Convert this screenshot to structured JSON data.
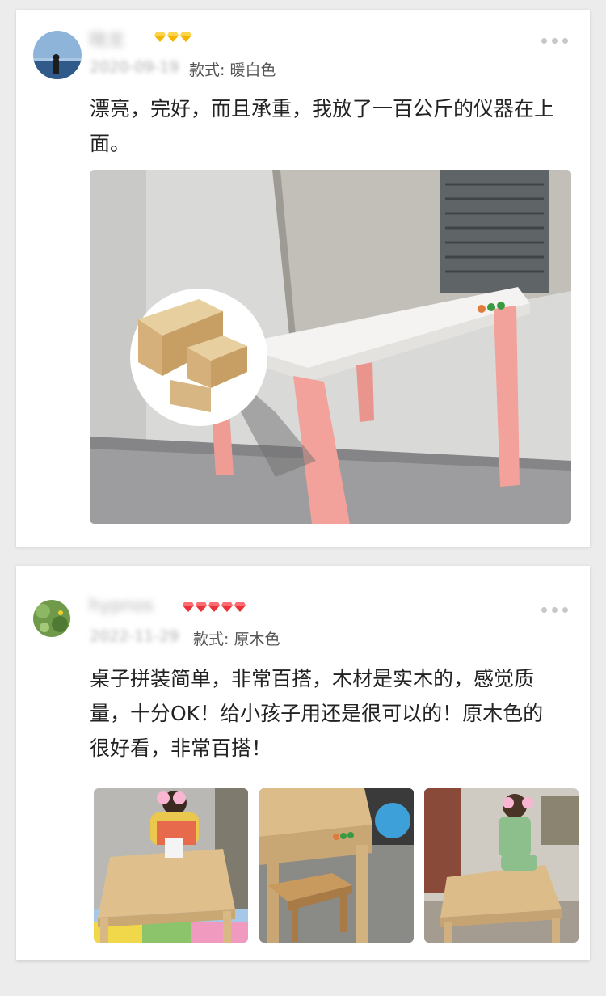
{
  "reviews": [
    {
      "username": "晓龙",
      "date": "2020-09-19",
      "variant": "款式: 暖白色",
      "text": "漂亮，完好，而且承重，我放了一百公斤的仪器在上面。",
      "photo_count": 1
    },
    {
      "username": "hypnos",
      "date": "2022-11-29",
      "variant": "款式: 原木色",
      "text": "桌子拼装简单，非常百搭，木材是实木的，感觉质量，十分OK！给小孩子用还是很可以的！原木色的很好看，非常百搭！",
      "photo_count": 3
    }
  ],
  "colors": {
    "gem_gold": "#f5b400",
    "gem_red": "#e8333b",
    "table_leg": "#f2a29a",
    "wood": "#dfc08d"
  }
}
